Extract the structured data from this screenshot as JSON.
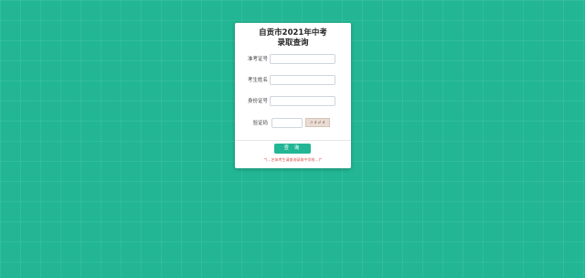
{
  "title": {
    "line1": "自贡市2021年中考",
    "line2": "录取查询"
  },
  "form": {
    "exam_id_label": "准考证号",
    "exam_id_value": "",
    "name_label": "考生姓名",
    "name_value": "",
    "id_card_label": "身份证号",
    "id_card_value": "",
    "captcha_label": "验证码",
    "captcha_value": "",
    "captcha_image_text": "3 4 d 4"
  },
  "submit_label": "查 询",
  "note": "*(…艺体考生请查询录取中学校…)*",
  "colors": {
    "background": "#22b694",
    "accent": "#22b694",
    "note": "#d9534f"
  }
}
